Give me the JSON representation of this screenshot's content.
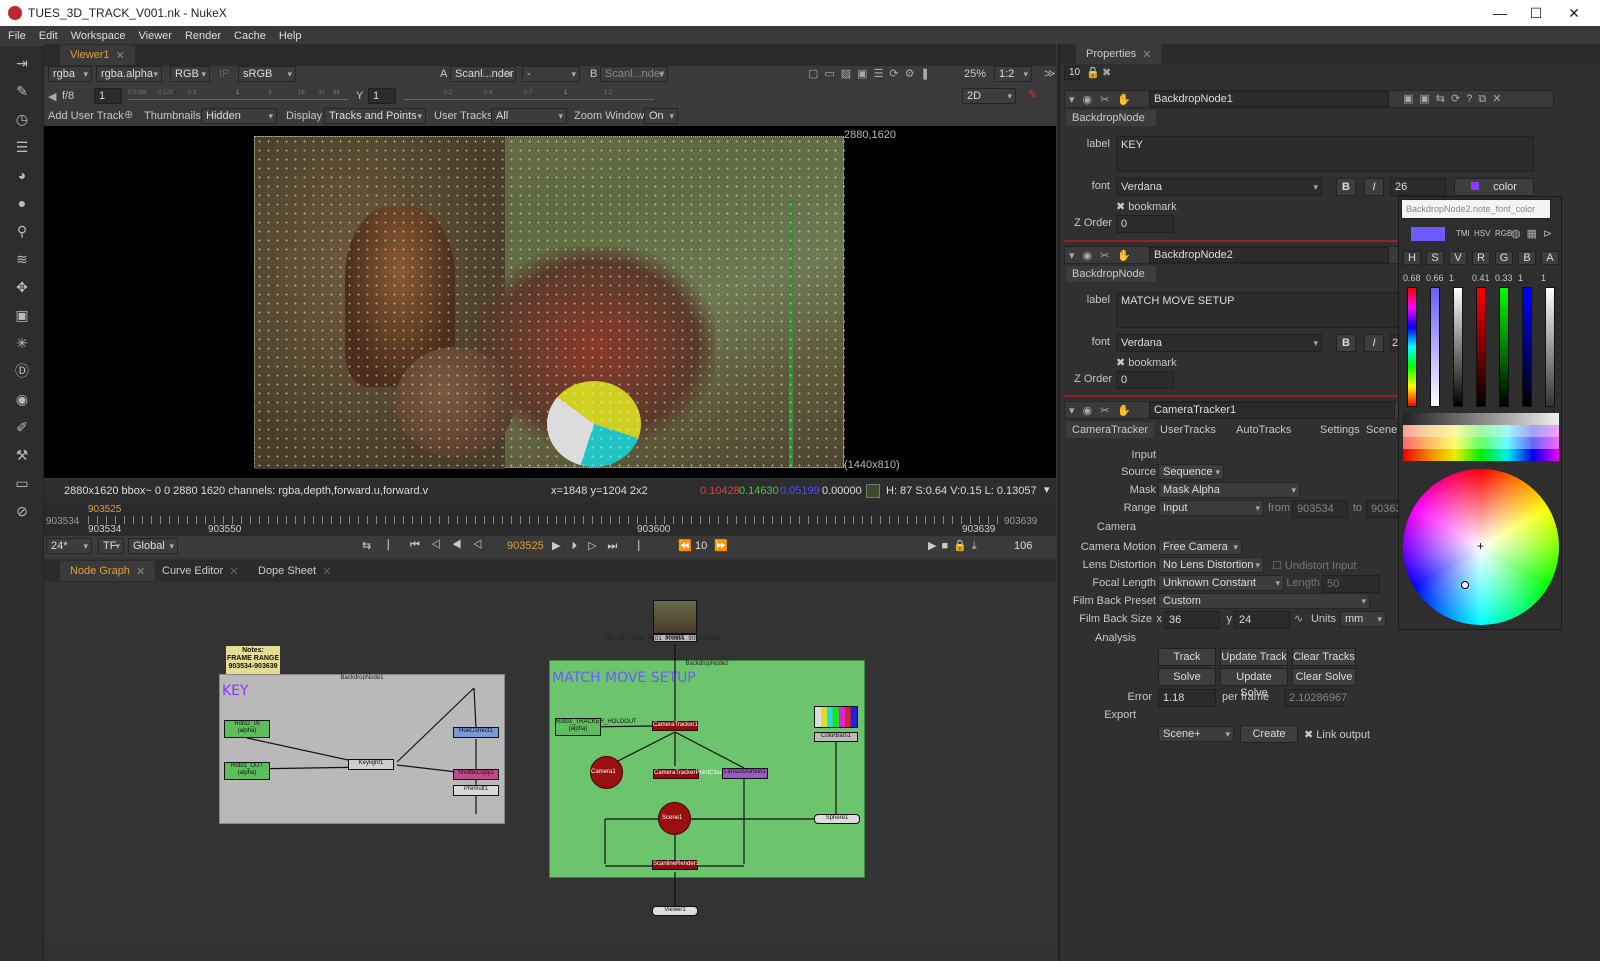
{
  "window": {
    "title": "TUES_3D_TRACK_V001.nk - NukeX",
    "min": "—",
    "max": "☐",
    "close": "✕"
  },
  "menu": [
    "File",
    "Edit",
    "Workspace",
    "Viewer",
    "Render",
    "Cache",
    "Help"
  ],
  "viewer": {
    "tab": "Viewer1",
    "channels": "rgba",
    "alpha": "rgba.alpha",
    "colorspace_rgb": "RGB",
    "ip": "IP",
    "lut": "sRGB",
    "inputA": "A",
    "inputA_val": "Scanl...nder",
    "minus": "-",
    "inputB": "B",
    "inputB_val": "Scanl...nder",
    "zoom": "25%",
    "ratio": "1:2",
    "fstop": "f/8",
    "gain": "1",
    "y_label": "Y",
    "gamma": "1",
    "mode2d": "2D",
    "gain_ticks": [
      "0.0156",
      "0.125",
      "0.3",
      "1",
      "3",
      "16",
      "30",
      "64"
    ],
    "gamma_ticks": [
      "0",
      "0.2",
      "0.4",
      "0.7",
      "1",
      "1.2",
      "1.6",
      "2"
    ],
    "add_user_track": "Add User Track",
    "thumbnails": "Thumbnails",
    "thumbnails_val": "Hidden",
    "display": "Display",
    "display_val": "Tracks and Points",
    "user_tracks": "User Tracks",
    "user_tracks_val": "All",
    "zoom_window": "Zoom Window",
    "zoom_window_val": "On",
    "format_tr": "2880,1620",
    "format_br": "(1440x810)",
    "info": "2880x1620  bbox~ 0 0 2880 1620 channels: rgba,depth,forward.u,forward.v",
    "coords": "x=1848 y=1204 2x2",
    "r": "0.10428",
    "g": "0.14630",
    "b": "0.05199",
    "a": "0.00000",
    "hsv": "H: 87 S:0.64 V:0.15  L: 0.13057"
  },
  "timeline": {
    "start": "903534",
    "end": "903639",
    "current": "903525",
    "mark1": "903534",
    "mark2": "903550",
    "mark3": "903600",
    "mark4": "903639",
    "fps": "24*",
    "tf": "TF",
    "global": "Global",
    "frame": "903525",
    "step": "10",
    "range": "106"
  },
  "nodegraph": {
    "tabs": [
      "Node Graph",
      "Curve Editor",
      "Dope Sheet"
    ],
    "sticky": "Notes:\nFRAME RANGE\n903534-903639",
    "backdrop1_title": "BackdropNode1",
    "backdrop1_label": "KEY",
    "backdrop2_title": "BackdropNode2",
    "backdrop2_label": "MATCH MOVE SETUP",
    "read": "Read1",
    "read_path": "SC_027_0200_PL01_903191_903534.dpx",
    "nodes": {
      "roto2": "Roto2_IN\n(alpha)",
      "roto1": "Roto1_OUT\n(alpha)",
      "keylight": "Keylight1",
      "huecorrect": "HueCorrect1",
      "shuffle": "ShuffleCopy1",
      "premult": "Premult1",
      "roto3": "Roto3_TRACKER_HOLDOUT\n(alpha)",
      "camtracker": "CameraTracker1",
      "camera": "Camera1",
      "pointcloud": "CameraTrackerPointCloud1",
      "lensdist": "LensDistortion1",
      "colorbars": "ColorBars1",
      "scene": "Scene1",
      "sphere": "Sphere1",
      "scanline": "ScanlineRender1",
      "viewer": "Viewer1"
    },
    "edge_labels": {
      "a": "mask",
      "b": "bg",
      "c": "Source",
      "d": "Camera",
      "e": "Cloud",
      "f": "cam",
      "g": "obj/scn",
      "h": "bg"
    }
  },
  "properties": {
    "tab": "Properties",
    "count": "10",
    "bd1": {
      "name": "BackdropNode1",
      "class": "BackdropNode",
      "label_lbl": "label",
      "label": "KEY",
      "font_lbl": "font",
      "font": "Verdana",
      "bold": "B",
      "italic": "I",
      "size": "26",
      "color_btn": "color",
      "bookmark": "bookmark",
      "zorder_lbl": "Z Order",
      "zorder": "0"
    },
    "bd2": {
      "name": "BackdropNode2",
      "class": "BackdropNode",
      "label_lbl": "label",
      "label": "MATCH MOVE SETUP",
      "font_lbl": "font",
      "font": "Verdana",
      "bold": "B",
      "italic": "I",
      "size": "2",
      "bookmark": "bookmark",
      "zorder_lbl": "Z Order",
      "zorder": "0"
    },
    "ct": {
      "name": "CameraTracker1",
      "tabs": [
        "CameraTracker",
        "UserTracks",
        "AutoTracks",
        "Settings",
        "Scene"
      ],
      "input_hdr": "Input",
      "source_lbl": "Source",
      "source": "Sequence",
      "mask_lbl": "Mask",
      "mask": "Mask Alpha",
      "range_lbl": "Range",
      "range": "Input",
      "from_lbl": "from",
      "from": "903534",
      "to_lbl": "to",
      "to": "903639",
      "camera_hdr": "Camera",
      "motion_lbl": "Camera Motion",
      "motion": "Free Camera",
      "lens_lbl": "Lens Distortion",
      "lens": "No Lens Distortion",
      "undistort": "Undistort Input",
      "focal_lbl": "Focal Length",
      "focal": "Unknown Constant",
      "length_lbl": "Length",
      "length": "50",
      "preset_lbl": "Film Back Preset",
      "preset": "Custom",
      "size_lbl": "Film Back Size",
      "x_lbl": "x",
      "x": "36",
      "y_lbl": "y",
      "y": "24",
      "units_lbl": "Units",
      "units": "mm",
      "analysis_hdr": "Analysis",
      "track": "Track",
      "update_track": "Update Track",
      "clear_tracks": "Clear Tracks",
      "solve": "Solve",
      "update_solve": "Update Solve",
      "clear_solve": "Clear Solve",
      "error_lbl": "Error",
      "error": "1.18",
      "perframe_lbl": "per frame",
      "perframe": "2.10286967",
      "export_hdr": "Export",
      "export": "Scene+",
      "create": "Create",
      "link": "Link output"
    }
  },
  "colorpicker": {
    "knob": "BackdropNode2.note_font_color",
    "modes": [
      "TMI",
      "HSV",
      "RGB"
    ],
    "channels": [
      "H",
      "S",
      "V",
      "R",
      "G",
      "B",
      "A"
    ],
    "values": [
      "0.68",
      "0.66",
      "1",
      "0.41",
      "0.33",
      "1",
      "1"
    ],
    "swatch": "#6b5bff"
  }
}
